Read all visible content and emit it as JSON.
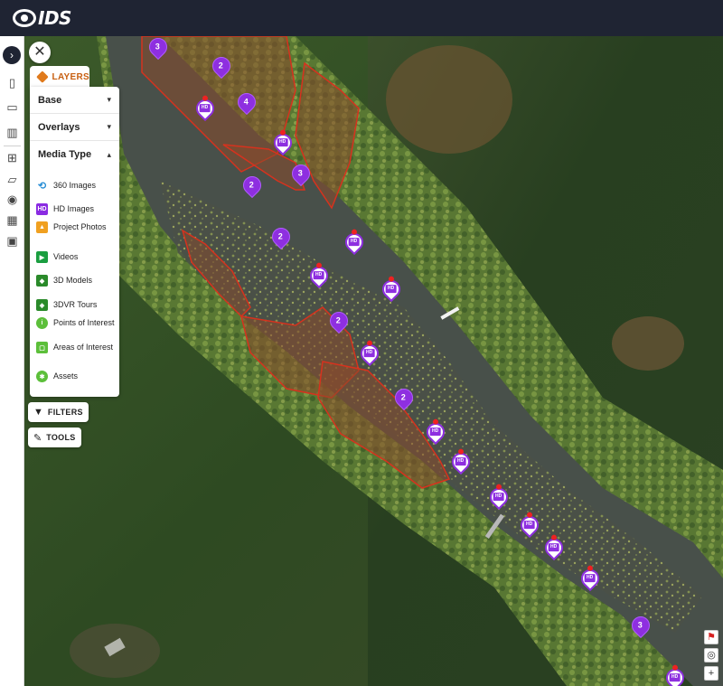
{
  "app": {
    "logo_text": "IDS"
  },
  "rail": {
    "items": [
      {
        "icon": "chevron-right-icon",
        "glyph": "›"
      },
      {
        "icon": "clipboard-icon",
        "glyph": "▯"
      },
      {
        "icon": "map-icon",
        "glyph": "▭"
      },
      {
        "icon": "bar-chart-icon",
        "glyph": "▥"
      },
      {
        "icon": "hierarchy-icon",
        "glyph": "⊞"
      },
      {
        "icon": "folder-icon",
        "glyph": "▱"
      },
      {
        "icon": "location-pin-icon",
        "glyph": "◉"
      },
      {
        "icon": "calendar-icon",
        "glyph": "▦"
      },
      {
        "icon": "gallery-icon",
        "glyph": "▣"
      }
    ]
  },
  "layers_panel": {
    "tab_label": "LAYERS",
    "sections": {
      "base": "Base",
      "overlays": "Overlays",
      "media_type": "Media Type"
    },
    "media_items": [
      {
        "label": "360 Images",
        "icon": "360-icon",
        "color": "#2a8fd6"
      },
      {
        "label": "HD Images",
        "icon": "hd-icon",
        "color": "#8a2be2"
      },
      {
        "label": "Project Photos",
        "icon": "photo-icon",
        "color": "#f0a020"
      },
      {
        "label": "Videos",
        "icon": "video-icon",
        "color": "#1a9e40"
      },
      {
        "label": "3D Models",
        "icon": "cube-icon",
        "color": "#2a8a2a"
      },
      {
        "label": "3DVR Tours",
        "icon": "vr-icon",
        "color": "#2a8a2a"
      },
      {
        "label": "Points of Interest",
        "icon": "info-icon",
        "color": "#5cbf3a"
      },
      {
        "label": "Areas of Interest",
        "icon": "area-icon",
        "color": "#5cbf3a"
      },
      {
        "label": "Assets",
        "icon": "asset-icon",
        "color": "#5cbf3a"
      }
    ]
  },
  "buttons": {
    "filters": "FILTERS",
    "tools": "TOOLS"
  },
  "map": {
    "accent_purple": "#8e2fe0",
    "polygon_color": "#c8301e",
    "cluster_markers": [
      {
        "count": "3"
      },
      {
        "count": "2"
      },
      {
        "count": "4"
      },
      {
        "count": "3"
      },
      {
        "count": "2"
      },
      {
        "count": "2"
      },
      {
        "count": "2"
      },
      {
        "count": "2"
      },
      {
        "count": "3"
      }
    ],
    "hd_label": "HD"
  }
}
